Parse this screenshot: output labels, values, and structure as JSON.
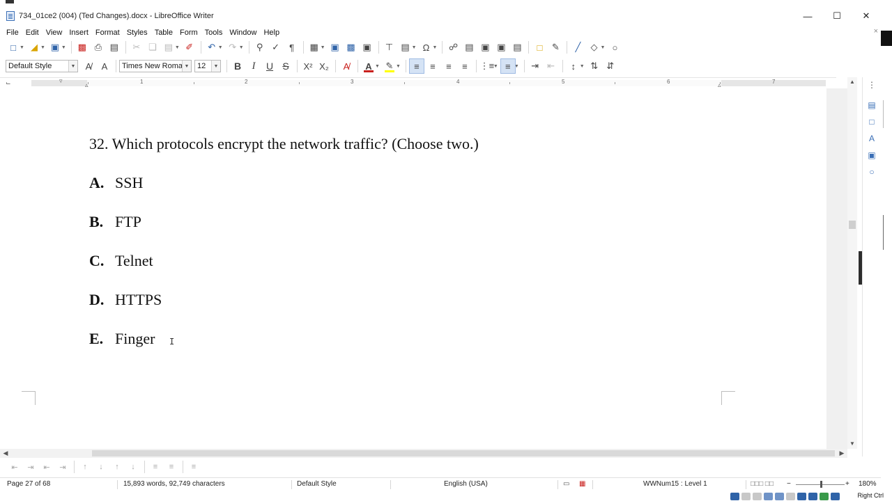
{
  "window": {
    "title": "734_01ce2 (004) (Ted Changes).docx - LibreOffice Writer",
    "minimize": "—",
    "maximize": "☐",
    "close": "✕"
  },
  "menubar": {
    "items": [
      {
        "label": "File",
        "accel": "F"
      },
      {
        "label": "Edit",
        "accel": "E"
      },
      {
        "label": "View",
        "accel": "V"
      },
      {
        "label": "Insert",
        "accel": "I"
      },
      {
        "label": "Format",
        "accel": ""
      },
      {
        "label": "Styles",
        "accel": ""
      },
      {
        "label": "Table",
        "accel": ""
      },
      {
        "label": "Form",
        "accel": ""
      },
      {
        "label": "Tools",
        "accel": ""
      },
      {
        "label": "Window",
        "accel": "W"
      },
      {
        "label": "Help",
        "accel": "H"
      }
    ],
    "close_doc": "×"
  },
  "formatting": {
    "paragraph_style": "Default Style",
    "font_name": "Times New Roman",
    "font_size": "12",
    "bold": "B",
    "italic": "I",
    "underline": "U",
    "strikethrough": "S",
    "superscript": "X²",
    "subscript": "X₂",
    "font_color_glyph": "A",
    "highlight_glyph": "✎",
    "font_color": "#c9211e",
    "highlight_color": "#ffff00"
  },
  "ruler": {
    "numbers": [
      "1",
      "2",
      "3",
      "4",
      "5",
      "6",
      "7"
    ]
  },
  "document": {
    "question": "32. Which protocols encrypt the network traffic? (Choose two.)",
    "options": [
      {
        "letter": "A.",
        "text": "SSH"
      },
      {
        "letter": "B.",
        "text": "FTP"
      },
      {
        "letter": "C.",
        "text": "Telnet"
      },
      {
        "letter": "D.",
        "text": "HTTPS"
      },
      {
        "letter": "E.",
        "text": "Finger"
      }
    ],
    "cursor_glyph": "I"
  },
  "statusbar": {
    "page": "Page 27 of 68",
    "word_count": "15,893 words, 92,749 characters",
    "page_style": "Default Style",
    "language": "English (USA)",
    "list_level": "WWNum15 : Level 1",
    "zoom": "180%",
    "zoom_minus": "−",
    "zoom_plus": "+"
  },
  "taskbar": {
    "label": "Right Ctrl"
  },
  "colors": {
    "accent": "#2f63a8",
    "active_button": "#d5e3f5"
  }
}
